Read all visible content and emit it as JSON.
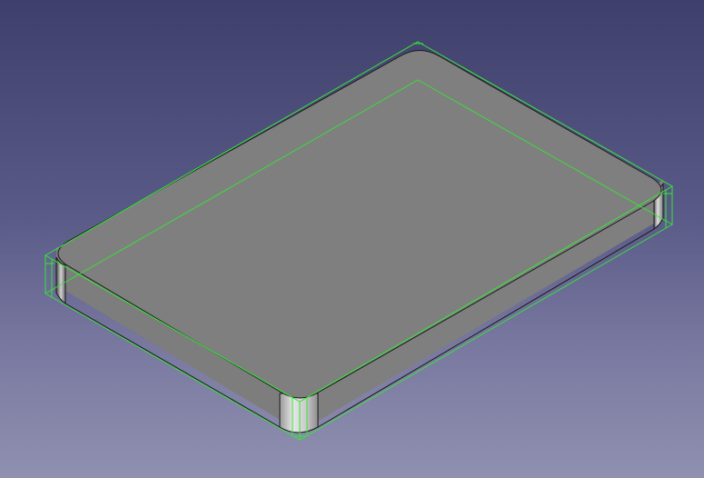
{
  "viewer": {
    "background_top": "#3f3f6c",
    "background_bottom": "#9090b0",
    "selection_color": "#33e833",
    "face_color": "#7f7f7f",
    "edge_color": "#1a1a1a"
  },
  "scene": {
    "object": "rounded-rectangular-plate",
    "highlight": "bounding-box"
  }
}
